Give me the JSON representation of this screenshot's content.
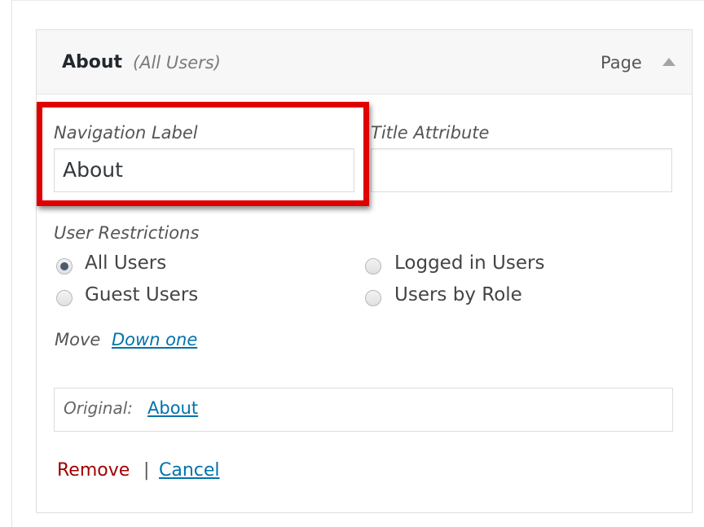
{
  "item": {
    "title": "About",
    "subtitle": "(All Users)",
    "type": "Page",
    "toggle_icon": "arrow-up-icon"
  },
  "fields": {
    "navigation_label": {
      "label": "Navigation Label",
      "value": "About"
    },
    "title_attribute": {
      "label": "Title Attribute",
      "value": ""
    }
  },
  "user_restrictions": {
    "label": "User Restrictions",
    "options": [
      {
        "label": "All Users",
        "checked": true
      },
      {
        "label": "Logged in Users",
        "checked": false
      },
      {
        "label": "Guest Users",
        "checked": false
      },
      {
        "label": "Users by Role",
        "checked": false
      }
    ]
  },
  "move": {
    "label": "Move",
    "link": "Down one"
  },
  "original": {
    "label": "Original:",
    "link": "About"
  },
  "actions": {
    "remove": "Remove",
    "separator": "|",
    "cancel": "Cancel"
  },
  "colors": {
    "highlight": "#e00000",
    "link": "#0073aa",
    "remove": "#a00000"
  }
}
